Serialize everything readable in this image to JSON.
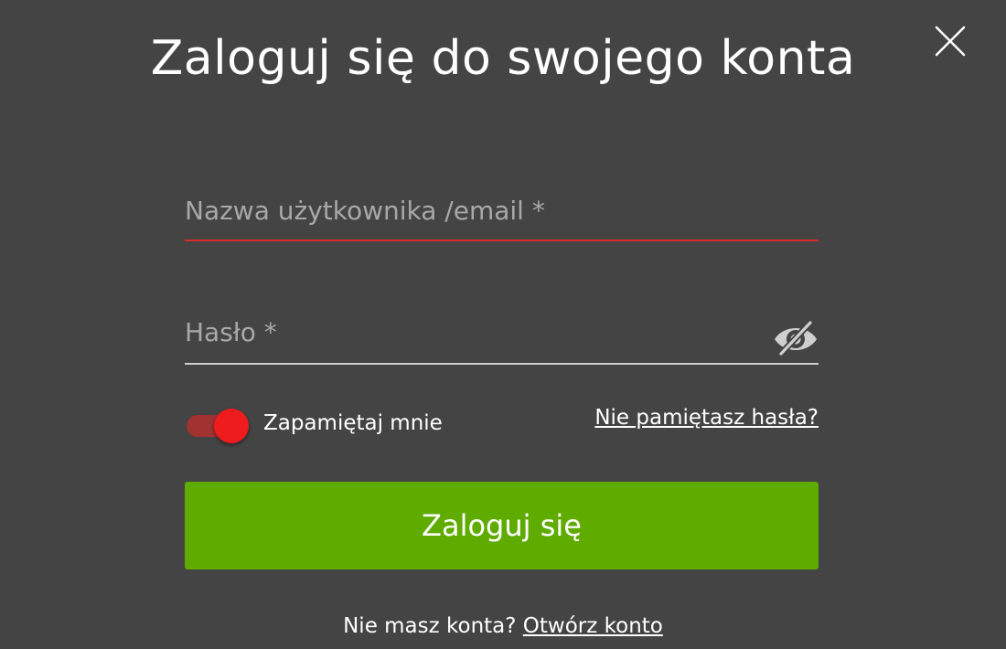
{
  "dialog": {
    "title": "Zaloguj się do swojego konta",
    "close_icon": "close-icon"
  },
  "form": {
    "username": {
      "value": "",
      "placeholder": "Nazwa użytkownika /email *",
      "underline_color": "#d62b2b"
    },
    "password": {
      "value": "",
      "placeholder": "Hasło *",
      "visibility_icon": "eye-slash-icon"
    },
    "remember": {
      "label": "Zapamiętaj mnie",
      "checked": true,
      "color": "#ee1c1c"
    },
    "forgot_label": "Nie pamiętasz hasła?",
    "submit_label": "Zaloguj się",
    "submit_color": "#5fab00"
  },
  "footer": {
    "no_account_text": "Nie masz konta?",
    "signup_label": "Otwórz konto"
  },
  "colors": {
    "background": "#444444",
    "text": "#ffffff"
  }
}
